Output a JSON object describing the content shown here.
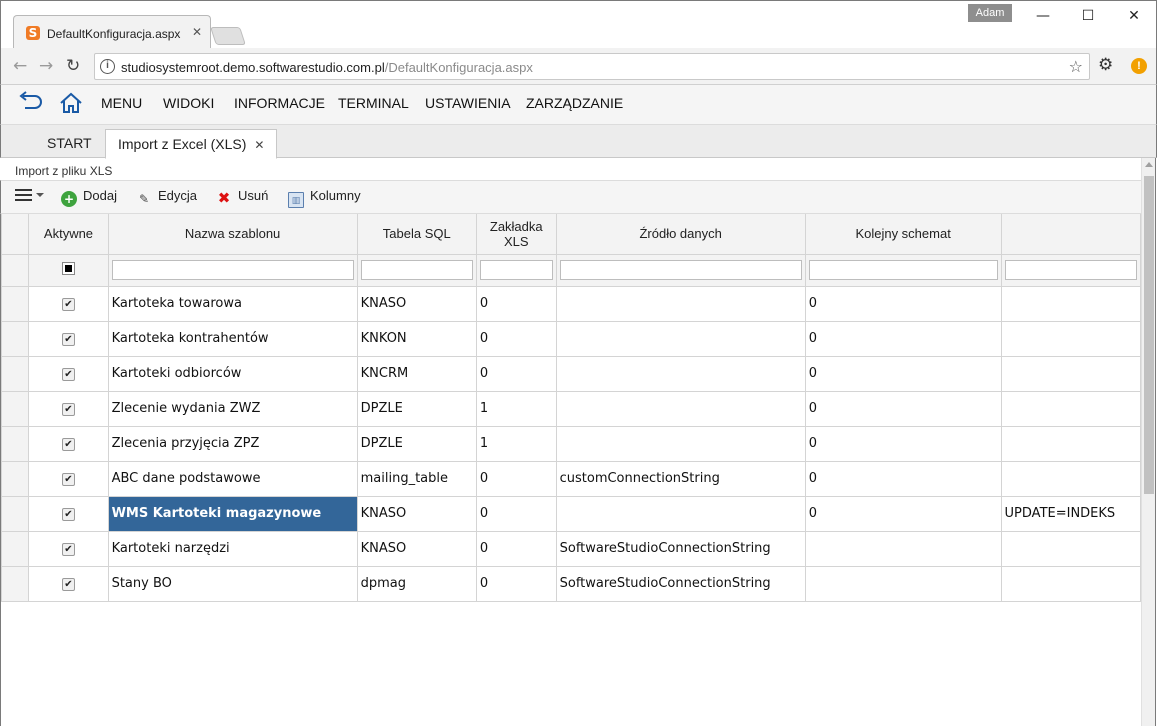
{
  "browser": {
    "tab_title": "DefaultKonfiguracja.aspx",
    "url_host": "studiosystemroot.demo.softwarestudio.com.pl",
    "url_path": "/DefaultKonfiguracja.aspx",
    "user": "Adam",
    "favicon_letter": "S"
  },
  "menu": {
    "items": [
      "MENU",
      "WIDOKI",
      "INFORMACJE",
      "TERMINAL",
      "USTAWIENIA",
      "ZARZĄDZANIE"
    ]
  },
  "tabs": {
    "start": "START",
    "active": "Import z Excel (XLS)"
  },
  "panel": {
    "title": "Import z pliku XLS"
  },
  "toolbar": {
    "add": "Dodaj",
    "edit": "Edycja",
    "delete": "Usuń",
    "columns": "Kolumny"
  },
  "grid": {
    "headers": {
      "active": "Aktywne",
      "name": "Nazwa szablonu",
      "table": "Tabela SQL",
      "sheet": "Zakładka XLS",
      "source": "Źródło danych",
      "next": "Kolejny schemat",
      "extra": ""
    },
    "rows": [
      {
        "active": true,
        "name": "Kartoteka towarowa",
        "table": "KNASO",
        "sheet": "0",
        "source": "",
        "next": "0",
        "extra": ""
      },
      {
        "active": true,
        "name": "Kartoteka kontrahentów",
        "table": "KNKON",
        "sheet": "0",
        "source": "",
        "next": "0",
        "extra": ""
      },
      {
        "active": true,
        "name": "Kartoteki odbiorców",
        "table": "KNCRM",
        "sheet": "0",
        "source": "",
        "next": "0",
        "extra": ""
      },
      {
        "active": true,
        "name": "Zlecenie wydania ZWZ",
        "table": "DPZLE",
        "sheet": "1",
        "source": "",
        "next": "0",
        "extra": ""
      },
      {
        "active": true,
        "name": "Zlecenia przyjęcia ZPZ",
        "table": "DPZLE",
        "sheet": "1",
        "source": "",
        "next": "0",
        "extra": ""
      },
      {
        "active": true,
        "name": "ABC dane podstawowe",
        "table": "mailing_table",
        "sheet": "0",
        "source": "customConnectionString",
        "next": "0",
        "extra": ""
      },
      {
        "active": true,
        "name": "WMS Kartoteki magazynowe",
        "table": "KNASO",
        "sheet": "0",
        "source": "",
        "next": "0",
        "extra": "UPDATE=INDEKS"
      },
      {
        "active": true,
        "name": "Kartoteki narzędzi",
        "table": "KNASO",
        "sheet": "0",
        "source": "SoftwareStudioConnectionString",
        "next": "",
        "extra": ""
      },
      {
        "active": true,
        "name": "Stany BO",
        "table": "dpmag",
        "sheet": "0",
        "source": "SoftwareStudioConnectionString",
        "next": "",
        "extra": ""
      }
    ],
    "selected_row": 6,
    "selection_color": "#336699"
  }
}
